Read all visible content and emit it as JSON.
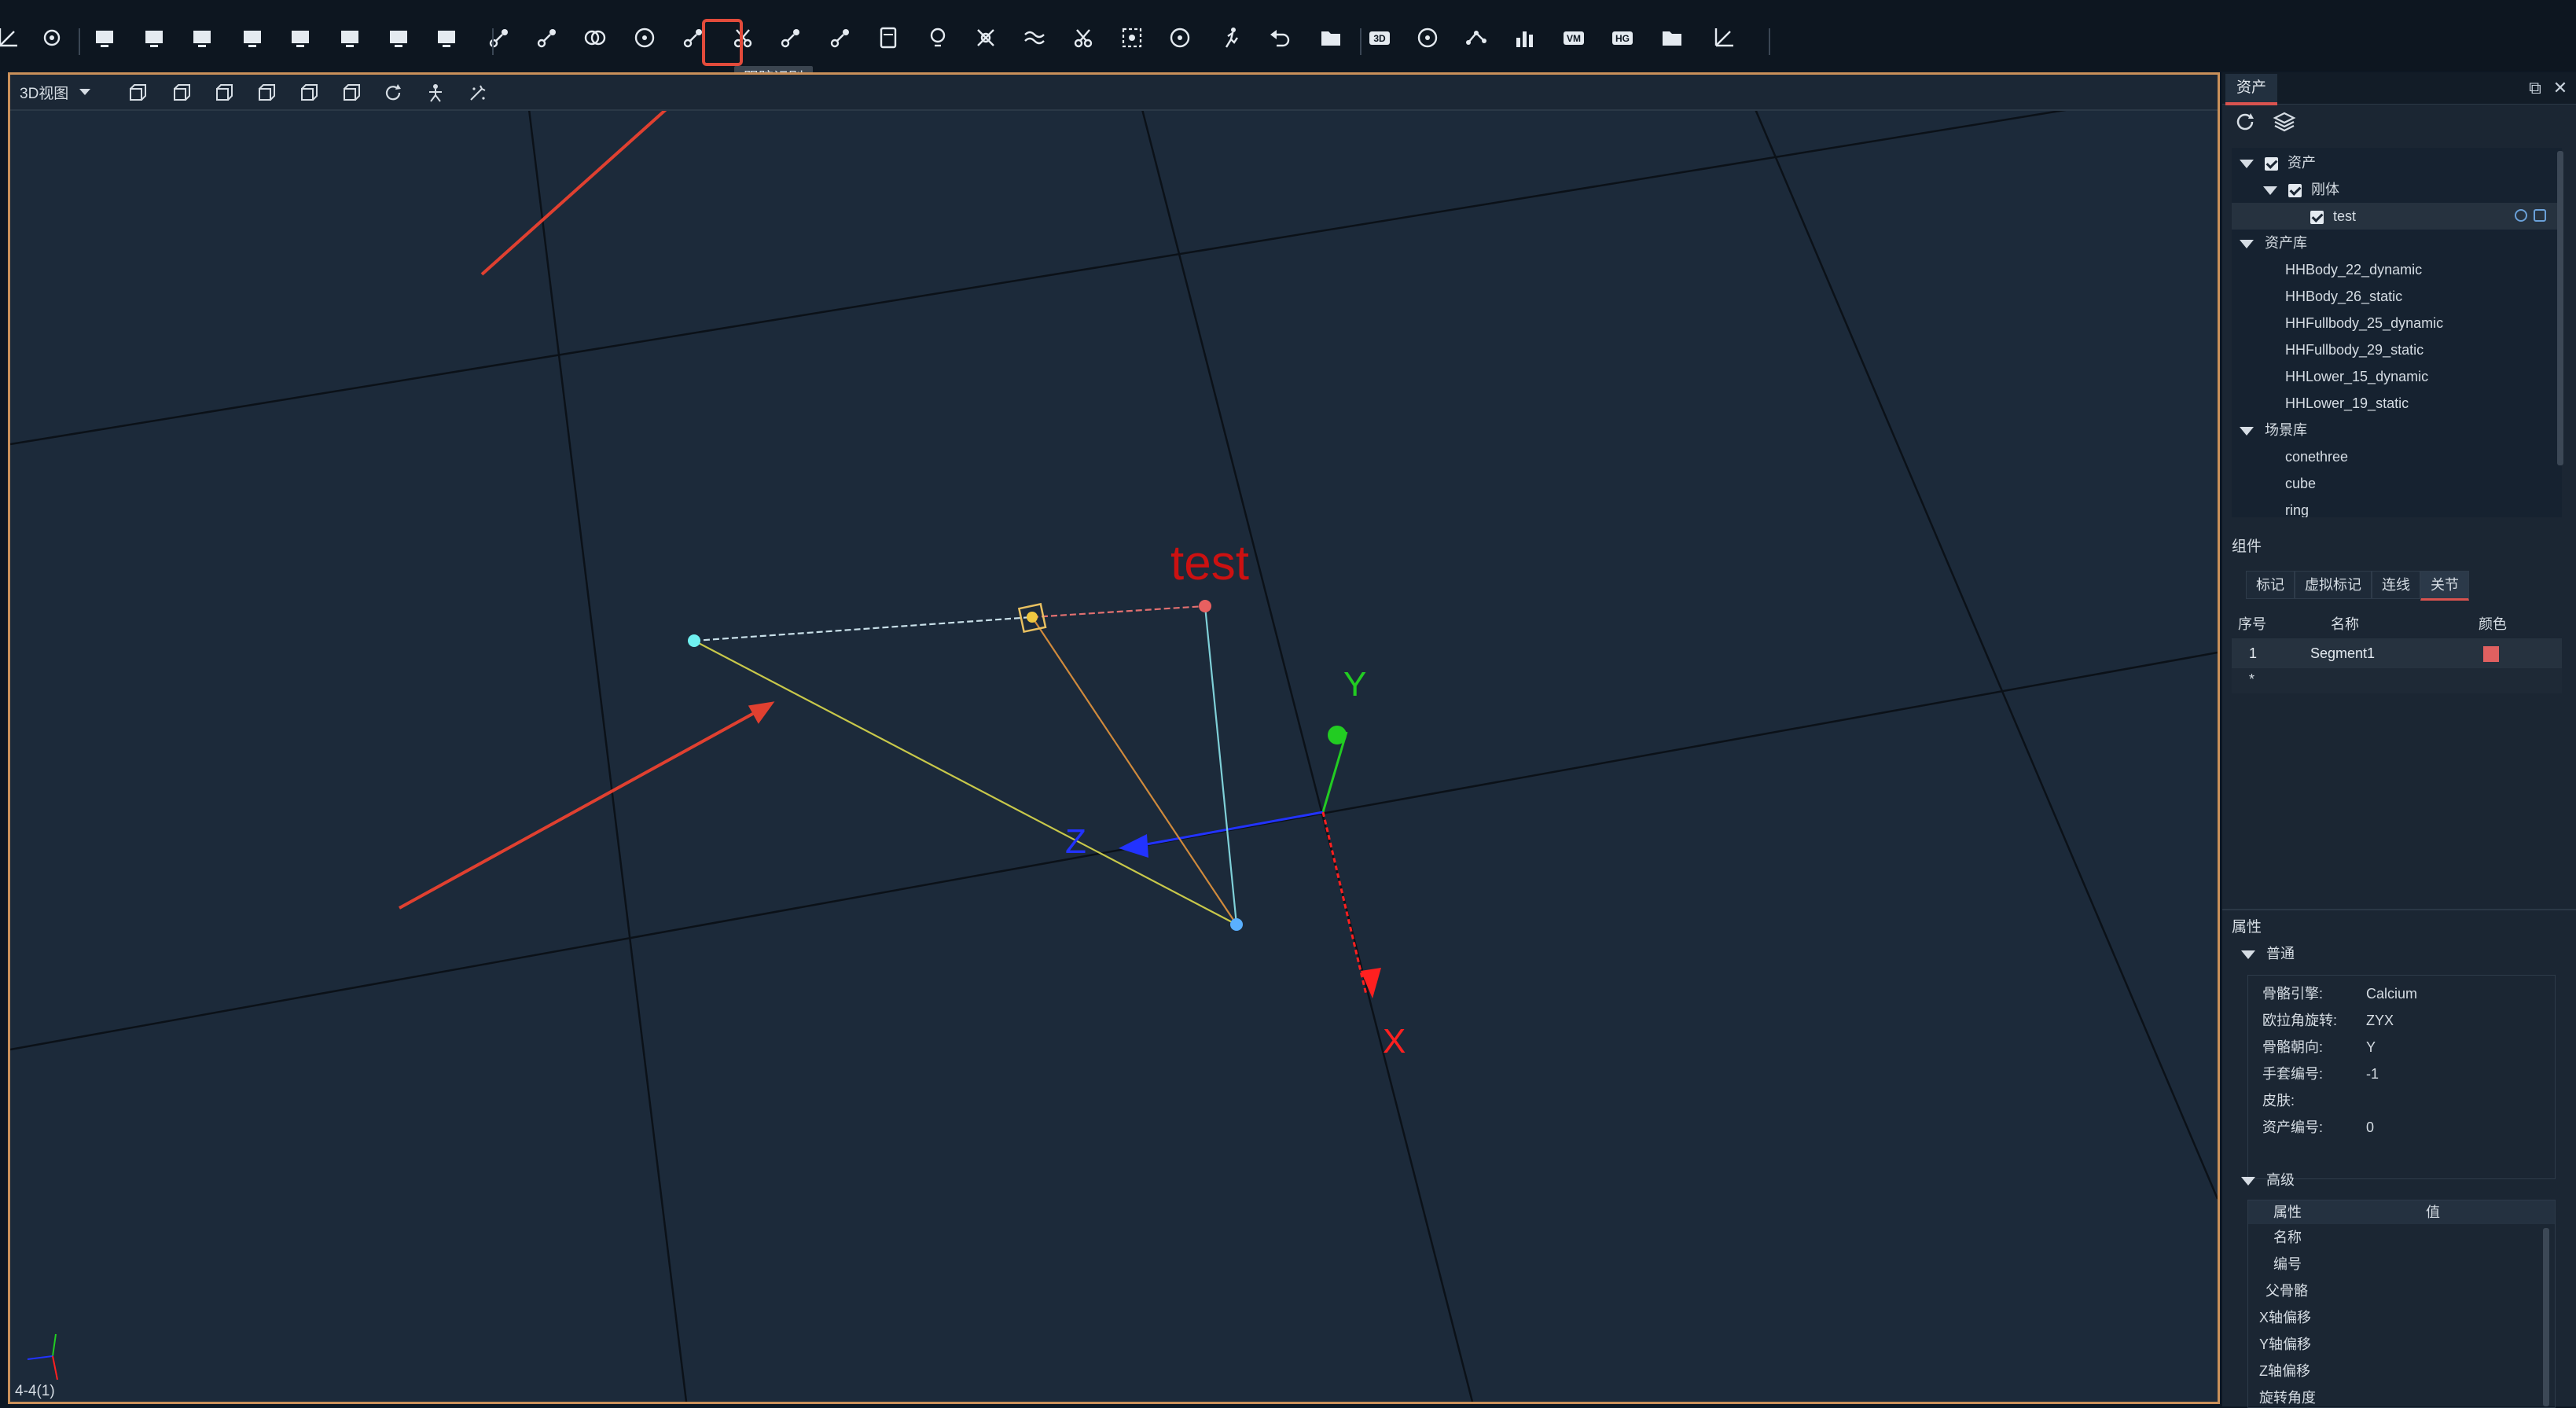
{
  "toolbar": {
    "tooltip": "跟踪识别",
    "icons": [
      "edit-icon",
      "gear-icon",
      "monitor-icon",
      "layout-two-row-icon",
      "layout-split-icon",
      "layout-four-icon",
      "layout-top-split-icon",
      "layout-left-split-icon",
      "layout-right-split-icon",
      "layout-grid-icon",
      "link-bone-icon",
      "atom-icon",
      "overlap-icon",
      "target-icon",
      "track-identify-icon",
      "scissors-icon",
      "bone-link-icon",
      "connect-icon",
      "calculator-icon",
      "bulb-icon",
      "cross-icon",
      "wave-icon",
      "cut-icon",
      "selection-icon",
      "rotate-icon",
      "run-icon",
      "undo-icon",
      "export-icon",
      "3d-badge-icon",
      "gauge-icon",
      "graph-icon",
      "bar-chart-icon",
      "vm-badge-icon",
      "hg-badge-icon",
      "folder-icon",
      "axes-icon"
    ]
  },
  "viewport": {
    "view_mode": "3D视图",
    "status": "4-4(1)",
    "object_label": "test",
    "axis_labels": {
      "x": "X",
      "y": "Y",
      "z": "Z"
    },
    "axis_colors": {
      "x": "#ff2020",
      "y": "#22cc22",
      "z": "#2233ff"
    },
    "label_color": "#cc1111",
    "toolbar_icons": [
      "cube-front-icon",
      "cube-back-icon",
      "cube-left-icon",
      "cube-right-icon",
      "cube-top-icon",
      "cube-bottom-icon",
      "refresh-view-icon",
      "skeleton-icon",
      "magic-icon"
    ]
  },
  "panel": {
    "tab": "资产",
    "controls": {
      "restore": "⧉",
      "close": "✕"
    },
    "tree": {
      "assets": "资产",
      "rigid_body": "刚体",
      "test_item": "test",
      "asset_library": "资产库",
      "library_items": [
        "HHBody_22_dynamic",
        "HHBody_26_static",
        "HHFullbody_25_dynamic",
        "HHFullbody_29_static",
        "HHLower_15_dynamic",
        "HHLower_19_static"
      ],
      "scene_library": "场景库",
      "scene_items": [
        "conethree",
        "cube",
        "ring"
      ]
    },
    "components": {
      "title": "组件",
      "tabs": [
        "标记",
        "虚拟标记",
        "连线",
        "关节"
      ],
      "active_tab": "关节",
      "columns": [
        "序号",
        "名称",
        "颜色"
      ],
      "rows": [
        {
          "index": "1",
          "name": "Segment1",
          "color": "#e06060"
        }
      ],
      "new_row_marker": "*"
    },
    "properties": {
      "title": "属性",
      "general": "普通",
      "general_rows": [
        {
          "label": "骨骼引擎:",
          "value": "Calcium"
        },
        {
          "label": "欧拉角旋转:",
          "value": "ZYX"
        },
        {
          "label": "骨骼朝向:",
          "value": "Y"
        },
        {
          "label": "手套编号:",
          "value": "-1"
        },
        {
          "label": "皮肤:",
          "value": ""
        },
        {
          "label": "资产编号:",
          "value": "0"
        }
      ],
      "advanced": "高级",
      "advanced_columns": [
        "属性",
        "值"
      ],
      "advanced_rows": [
        "名称",
        "编号",
        "父骨骼",
        "X轴偏移",
        "Y轴偏移",
        "Z轴偏移",
        "旋转角度"
      ]
    }
  }
}
